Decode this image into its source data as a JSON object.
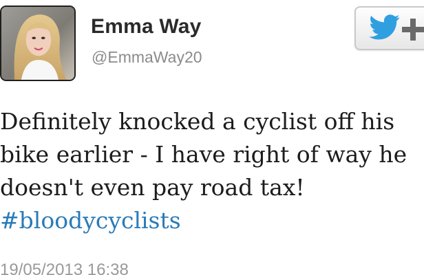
{
  "tweet": {
    "author_name": "Emma Way",
    "author_handle": "@EmmaWay20",
    "follow_button_plus": "+",
    "text_lines": [
      "Definitely knocked a cyclist off his",
      "bike earlier - I have right of way he",
      "doesn't even pay road tax!"
    ],
    "hashtag": "#bloodycyclists",
    "timestamp": "19/05/2013 16:38"
  },
  "icons": {
    "follow": "twitter-bird-icon",
    "follow_plus": "plus-icon"
  },
  "colors": {
    "name": "#2a2a2a",
    "handle": "#8b8b8b",
    "hashtag": "#2a7bb8",
    "twitter_blue": "#2f9fe0",
    "timestamp": "#999999"
  }
}
